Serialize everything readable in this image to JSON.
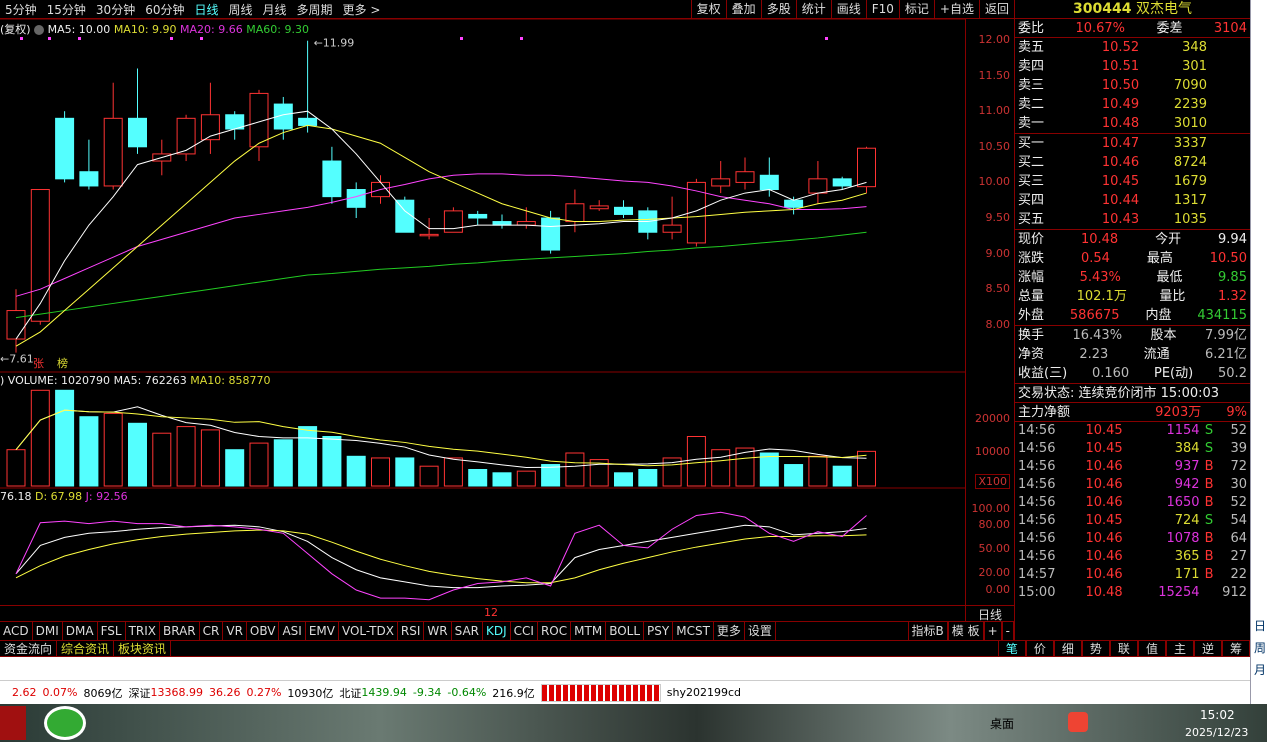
{
  "topbar": {
    "periods": [
      "5分钟",
      "15分钟",
      "30分钟",
      "60分钟",
      "日线",
      "周线",
      "月线",
      "多周期",
      "更多 >"
    ],
    "active": "日线",
    "tools": [
      "复权",
      "叠加",
      "多股",
      "统计",
      "画线",
      "F10",
      "标记",
      "+自选",
      "返回"
    ]
  },
  "ma_legend": {
    "prefix": "(复权)",
    "ma5": "MA5: 10.00",
    "ma10": "MA10: 9.90",
    "ma20": "MA20: 9.66",
    "ma60": "MA60: 9.30"
  },
  "colors": {
    "up": "#ff3333",
    "down": "#54ffff",
    "ma5": "#ffffff",
    "ma10": "#ffff44",
    "ma20": "#ff44ff",
    "ma60": "#22cc22"
  },
  "chart_data": {
    "type": "candlestick",
    "price_ticks": [
      "12.00",
      "11.50",
      "11.00",
      "10.50",
      "10.00",
      "9.50",
      "9.00",
      "8.50",
      "8.00"
    ],
    "high_label": "11.99",
    "low_label": "7.61",
    "marks": [
      "张",
      "榜"
    ],
    "candles": [
      [
        7.8,
        8.2,
        7.61,
        8.5
      ],
      [
        8.05,
        9.9,
        8.0,
        9.9
      ],
      [
        10.9,
        10.05,
        10.0,
        11.0
      ],
      [
        10.15,
        9.95,
        9.9,
        10.6
      ],
      [
        9.95,
        10.9,
        9.9,
        11.4
      ],
      [
        10.9,
        10.5,
        10.4,
        11.6
      ],
      [
        10.3,
        10.4,
        10.1,
        10.6
      ],
      [
        10.4,
        10.9,
        10.3,
        10.95
      ],
      [
        10.6,
        10.95,
        10.4,
        11.4
      ],
      [
        10.95,
        10.75,
        10.6,
        11.0
      ],
      [
        10.5,
        11.25,
        10.3,
        11.3
      ],
      [
        11.1,
        10.75,
        10.6,
        11.2
      ],
      [
        10.9,
        10.8,
        10.7,
        11.99
      ],
      [
        10.3,
        9.8,
        9.7,
        10.5
      ],
      [
        9.9,
        9.65,
        9.5,
        10.0
      ],
      [
        9.8,
        10.0,
        9.7,
        10.1
      ],
      [
        9.75,
        9.3,
        9.3,
        9.8
      ],
      [
        9.25,
        9.27,
        9.2,
        9.5
      ],
      [
        9.3,
        9.6,
        9.3,
        9.65
      ],
      [
        9.55,
        9.5,
        9.4,
        9.6
      ],
      [
        9.45,
        9.4,
        9.35,
        9.55
      ],
      [
        9.4,
        9.45,
        9.35,
        9.65
      ],
      [
        9.5,
        9.05,
        9.0,
        9.6
      ],
      [
        9.45,
        9.7,
        9.3,
        9.9
      ],
      [
        9.63,
        9.67,
        9.6,
        9.75
      ],
      [
        9.65,
        9.55,
        9.5,
        9.75
      ],
      [
        9.6,
        9.3,
        9.2,
        9.65
      ],
      [
        9.3,
        9.4,
        9.2,
        9.8
      ],
      [
        9.15,
        10.0,
        9.1,
        10.05
      ],
      [
        9.95,
        10.05,
        9.85,
        10.3
      ],
      [
        10.0,
        10.15,
        9.9,
        10.35
      ],
      [
        10.1,
        9.9,
        9.8,
        10.35
      ],
      [
        9.75,
        9.65,
        9.55,
        9.8
      ],
      [
        9.85,
        10.05,
        9.7,
        10.3
      ],
      [
        10.05,
        9.95,
        9.9,
        10.08
      ],
      [
        9.94,
        10.48,
        9.85,
        10.5
      ]
    ],
    "ma5": [
      7.8,
      8.3,
      8.9,
      9.4,
      9.8,
      10.25,
      10.35,
      10.45,
      10.65,
      10.75,
      10.85,
      10.95,
      11.0,
      10.75,
      10.4,
      10.0,
      9.6,
      9.35,
      9.35,
      9.4,
      9.4,
      9.4,
      9.38,
      9.4,
      9.42,
      9.45,
      9.45,
      9.5,
      9.6,
      9.75,
      9.85,
      9.9,
      9.75,
      9.85,
      9.9,
      10.0
    ],
    "ma10": [
      7.7,
      7.9,
      8.2,
      8.5,
      8.8,
      9.1,
      9.4,
      9.7,
      10.0,
      10.3,
      10.55,
      10.7,
      10.8,
      10.75,
      10.65,
      10.55,
      10.35,
      10.15,
      10.0,
      9.85,
      9.7,
      9.6,
      9.5,
      9.45,
      9.45,
      9.47,
      9.48,
      9.5,
      9.52,
      9.55,
      9.58,
      9.6,
      9.62,
      9.7,
      9.75,
      9.85
    ],
    "ma20": [
      8.4,
      8.5,
      8.65,
      8.8,
      8.95,
      9.1,
      9.2,
      9.3,
      9.4,
      9.5,
      9.55,
      9.6,
      9.65,
      9.72,
      9.8,
      9.9,
      9.97,
      10.05,
      10.1,
      10.12,
      10.12,
      10.1,
      10.1,
      10.08,
      10.05,
      10.02,
      10.0,
      9.95,
      9.88,
      9.8,
      9.75,
      9.7,
      9.62,
      9.62,
      9.63,
      9.66
    ],
    "ma60": [
      8.1,
      8.15,
      8.2,
      8.25,
      8.3,
      8.35,
      8.4,
      8.45,
      8.5,
      8.55,
      8.6,
      8.65,
      8.7,
      8.72,
      8.75,
      8.78,
      8.8,
      8.82,
      8.85,
      8.87,
      8.9,
      8.92,
      8.94,
      8.96,
      8.98,
      9.0,
      9.03,
      9.05,
      9.08,
      9.1,
      9.13,
      9.16,
      9.19,
      9.22,
      9.26,
      9.3
    ],
    "volume_label": "VOLUME: 1020790",
    "vol_ma5_label": "MA5: 762263",
    "vol_ma10_label": "MA10: 858770",
    "vol_prefix": ")",
    "volume_ticks": [
      "20000",
      "10000"
    ],
    "volume_unit": "X100",
    "volume": [
      11000,
      29000,
      29000,
      21000,
      22000,
      19000,
      16000,
      18000,
      17000,
      11000,
      13000,
      14000,
      18000,
      15000,
      9000,
      8500,
      8500,
      6000,
      8500,
      5000,
      4000,
      4500,
      6500,
      10000,
      8000,
      4000,
      5000,
      8500,
      15000,
      11000,
      11500,
      10000,
      6500,
      9000,
      6000,
      10500
    ],
    "kdj_label_k": "76.18",
    "kdj_label_d": "D: 67.98",
    "kdj_label_j": "J: 92.56",
    "kdj_ticks": [
      "100.00",
      "80.00",
      "50.00",
      "20.00",
      "0.00"
    ],
    "K": [
      20,
      55,
      65,
      70,
      72,
      75,
      77,
      78,
      79,
      80,
      78,
      72,
      60,
      40,
      25,
      15,
      10,
      5,
      3,
      3,
      5,
      6,
      8,
      40,
      50,
      55,
      60,
      65,
      70,
      75,
      80,
      78,
      68,
      70,
      72,
      76
    ],
    "D": [
      15,
      30,
      42,
      50,
      57,
      62,
      66,
      69,
      71,
      73,
      74,
      73,
      69,
      59,
      48,
      38,
      30,
      23,
      18,
      14,
      11,
      9,
      9,
      15,
      25,
      33,
      40,
      47,
      53,
      58,
      63,
      66,
      66,
      67,
      67,
      68
    ],
    "J": [
      20,
      83,
      85,
      82,
      85,
      82,
      82,
      78,
      80,
      78,
      75,
      70,
      45,
      20,
      0,
      -10,
      -10,
      -12,
      0,
      8,
      10,
      15,
      5,
      70,
      80,
      55,
      52,
      75,
      92,
      96,
      90,
      70,
      60,
      72,
      66,
      92
    ],
    "x_label": "12",
    "period_label": "日线"
  },
  "indicator_tabs": [
    "ACD",
    "DMI",
    "DMA",
    "FSL",
    "TRIX",
    "BRAR",
    "CR",
    "VR",
    "OBV",
    "ASI",
    "EMV",
    "VOL-TDX",
    "RSI",
    "WR",
    "SAR",
    "KDJ",
    "CCI",
    "ROC",
    "MTM",
    "BOLL",
    "PSY",
    "MCST",
    "更多",
    "设置"
  ],
  "indicator_right": [
    "指标B",
    "模 板",
    "+",
    "-"
  ],
  "bottom_tabs": [
    "资金流向",
    "综合资讯",
    "板块资讯"
  ],
  "right_tabs": [
    "笔",
    "价",
    "细",
    "势",
    "联",
    "值",
    "主",
    "逆",
    "筹"
  ],
  "stock": {
    "code": "300444",
    "name": "双杰电气",
    "webi_label": "委比",
    "webi": "10.67%",
    "weicha_label": "委差",
    "weicha": "3104"
  },
  "asks": [
    [
      "卖五",
      "10.52",
      "348"
    ],
    [
      "卖四",
      "10.51",
      "301"
    ],
    [
      "卖三",
      "10.50",
      "7090"
    ],
    [
      "卖二",
      "10.49",
      "2239"
    ],
    [
      "卖一",
      "10.48",
      "3010"
    ]
  ],
  "bids": [
    [
      "买一",
      "10.47",
      "3337"
    ],
    [
      "买二",
      "10.46",
      "8724"
    ],
    [
      "买三",
      "10.45",
      "1679"
    ],
    [
      "买四",
      "10.44",
      "1317"
    ],
    [
      "买五",
      "10.43",
      "1035"
    ]
  ],
  "quote": [
    [
      "现价",
      "10.48",
      "今开",
      "9.94"
    ],
    [
      "涨跌",
      "0.54",
      "最高",
      "10.50"
    ],
    [
      "涨幅",
      "5.43%",
      "最低",
      "9.85"
    ],
    [
      "总量",
      "102.1万",
      "量比",
      "1.32"
    ],
    [
      "外盘",
      "586675",
      "内盘",
      "434115"
    ]
  ],
  "quote2": [
    [
      "换手",
      "16.43%",
      "股本",
      "7.99亿"
    ],
    [
      "净资",
      "2.23",
      "流通",
      "6.21亿"
    ],
    [
      "收益(三)",
      "0.160",
      "PE(动)",
      "50.2"
    ]
  ],
  "trade_status": "交易状态: 连续竞价闭市 15:00:03",
  "main_flow": {
    "label": "主力净额",
    "value": "9203万",
    "pct": "9%"
  },
  "ticks": [
    [
      "14:56",
      "10.45",
      "1154",
      "S",
      "52"
    ],
    [
      "14:56",
      "10.45",
      "384",
      "S",
      "39"
    ],
    [
      "14:56",
      "10.46",
      "937",
      "B",
      "72"
    ],
    [
      "14:56",
      "10.46",
      "942",
      "B",
      "30"
    ],
    [
      "14:56",
      "10.46",
      "1650",
      "B",
      "52"
    ],
    [
      "14:56",
      "10.45",
      "724",
      "S",
      "54"
    ],
    [
      "14:56",
      "10.46",
      "1078",
      "B",
      "64"
    ],
    [
      "14:56",
      "10.46",
      "365",
      "B",
      "27"
    ],
    [
      "14:57",
      "10.46",
      "171",
      "B",
      "22"
    ],
    [
      "15:00",
      "10.48",
      "15254",
      "",
      "912"
    ]
  ],
  "status": {
    "sh_chg": "2.62",
    "sh_pct": "0.07%",
    "sh_amt": "8069亿",
    "sz_label": "深证",
    "sz": "13368.99",
    "sz_chg": "36.26",
    "sz_pct": "0.27%",
    "sz_amt": "10930亿",
    "bz_label": "北证",
    "bz": "1439.94",
    "bz_chg": "-9.34",
    "bz_pct": "-0.64%",
    "bz_amt": "216.9亿",
    "user": "shy202199cd"
  },
  "taskbar": {
    "desktop": "桌面",
    "time": "15:02",
    "date": "2025/12/23"
  },
  "strip": [
    "日",
    "周",
    "月"
  ]
}
